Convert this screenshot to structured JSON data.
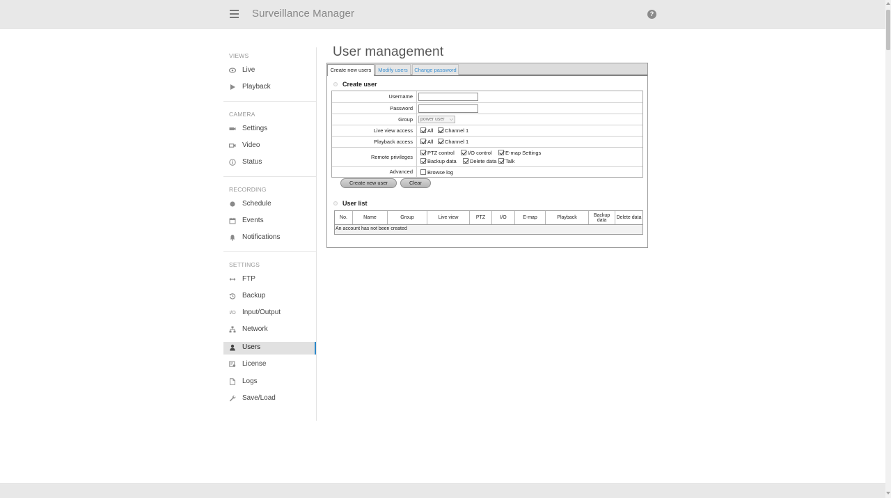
{
  "header": {
    "title": "Surveillance Manager",
    "menu_icon": "hamburger-icon",
    "help_icon": "question-icon",
    "help_glyph": "?"
  },
  "sidebar": {
    "sections": [
      {
        "heading": "VIEWS",
        "items": [
          {
            "label": "Live",
            "icon": "eye-icon"
          },
          {
            "label": "Playback",
            "icon": "play-icon"
          }
        ]
      },
      {
        "heading": "CAMERA",
        "items": [
          {
            "label": "Settings",
            "icon": "camera-icon"
          },
          {
            "label": "Video",
            "icon": "video-icon"
          },
          {
            "label": "Status",
            "icon": "info-icon"
          }
        ]
      },
      {
        "heading": "RECORDING",
        "items": [
          {
            "label": "Schedule",
            "icon": "record-dot-icon"
          },
          {
            "label": "Events",
            "icon": "calendar-icon"
          },
          {
            "label": "Notifications",
            "icon": "bell-icon"
          }
        ]
      },
      {
        "heading": "SETTINGS",
        "items": [
          {
            "label": "FTP",
            "icon": "transfer-arrows-icon"
          },
          {
            "label": "Backup",
            "icon": "history-icon"
          },
          {
            "label": "Input/Output",
            "icon": "io-icon",
            "glyph": "I/O"
          },
          {
            "label": "Network",
            "icon": "network-icon"
          },
          {
            "label": "Users",
            "icon": "user-icon",
            "active": true
          },
          {
            "label": "License",
            "icon": "license-icon"
          },
          {
            "label": "Logs",
            "icon": "file-icon"
          },
          {
            "label": "Save/Load",
            "icon": "wrench-icon"
          }
        ]
      }
    ]
  },
  "main": {
    "title": "User management",
    "tabs": [
      {
        "label": "Create new users",
        "active": true
      },
      {
        "label": "Modify users",
        "active": false
      },
      {
        "label": "Change password",
        "active": false
      }
    ],
    "create_user": {
      "title": "Create user",
      "fields": {
        "username": {
          "label": "Username",
          "value": ""
        },
        "password": {
          "label": "Password",
          "value": ""
        },
        "group": {
          "label": "Group",
          "value": "power user"
        },
        "live_view_access": {
          "label": "Live view access",
          "options": [
            {
              "label": "All",
              "checked": true
            },
            {
              "label": "Channel 1",
              "checked": true
            }
          ]
        },
        "playback_access": {
          "label": "Playback access",
          "options": [
            {
              "label": "All",
              "checked": true
            },
            {
              "label": "Channel 1",
              "checked": true
            }
          ]
        },
        "remote_privileges": {
          "label": "Remote privileges",
          "options": [
            {
              "label": "PTZ control",
              "checked": true
            },
            {
              "label": "I/O control",
              "checked": true
            },
            {
              "label": "E-map Settings",
              "checked": true
            },
            {
              "label": "Backup data",
              "checked": true
            },
            {
              "label": "Delete data",
              "checked": true
            },
            {
              "label": "Talk",
              "checked": true
            }
          ]
        },
        "advanced": {
          "label": "Advanced",
          "options": [
            {
              "label": "Browse log",
              "checked": false
            }
          ]
        }
      },
      "buttons": {
        "create": "Create new user",
        "clear": "Clear"
      }
    },
    "user_list": {
      "title": "User list",
      "columns": [
        "No.",
        "Name",
        "Group",
        "Live view",
        "PTZ",
        "I/O",
        "E-map",
        "Playback",
        "Backup data",
        "Delete data"
      ],
      "empty_message": "An account has not been created"
    }
  }
}
